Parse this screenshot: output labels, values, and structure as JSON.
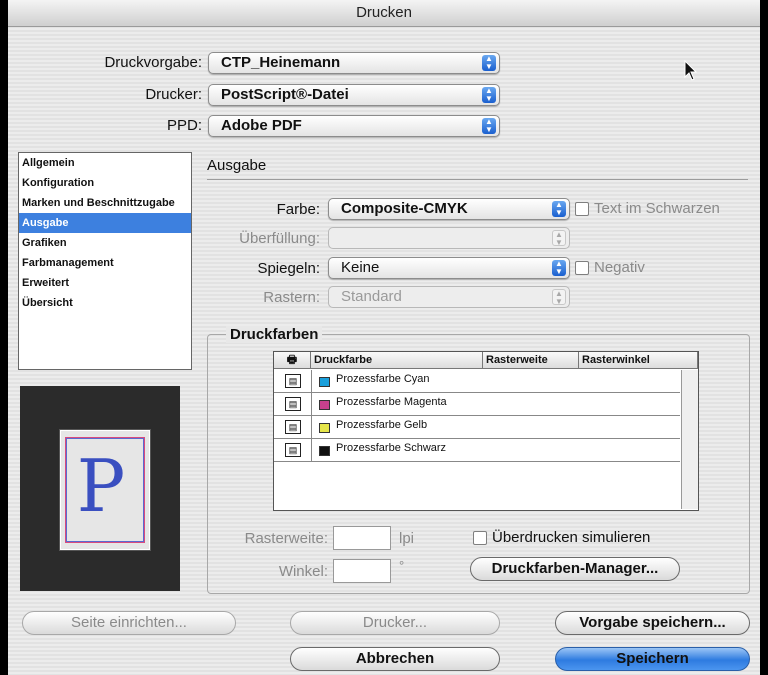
{
  "window": {
    "title": "Drucken"
  },
  "top_fields": {
    "preset_label": "Druckvorgabe:",
    "preset_value": "CTP_Heinemann",
    "printer_label": "Drucker:",
    "printer_value": "PostScript®-Datei",
    "ppd_label": "PPD:",
    "ppd_value": "Adobe PDF"
  },
  "sidebar": {
    "items": [
      {
        "label": "Allgemein"
      },
      {
        "label": "Konfiguration"
      },
      {
        "label": "Marken und Beschnittzugabe"
      },
      {
        "label": "Ausgabe"
      },
      {
        "label": "Grafiken"
      },
      {
        "label": "Farbmanagement"
      },
      {
        "label": "Erweitert"
      },
      {
        "label": "Übersicht"
      }
    ],
    "selected": "Ausgabe"
  },
  "preview": {
    "letter": "P"
  },
  "output": {
    "section_title": "Ausgabe",
    "color_label": "Farbe:",
    "color_value": "Composite-CMYK",
    "text_black_label": "Text im Schwarzen",
    "trapping_label": "Überfüllung:",
    "trapping_value": "",
    "mirror_label": "Spiegeln:",
    "mirror_value": "Keine",
    "negative_label": "Negativ",
    "screening_label": "Rastern:",
    "screening_value": "Standard"
  },
  "inks": {
    "group_title": "Druckfarben",
    "columns": [
      "Druckfarbe",
      "Rasterweite",
      "Rasterwinkel"
    ],
    "rows": [
      {
        "name": "Prozessfarbe Cyan",
        "color": "#1aa0dc"
      },
      {
        "name": "Prozessfarbe Magenta",
        "color": "#c8408c"
      },
      {
        "name": "Prozessfarbe Gelb",
        "color": "#e6e64a"
      },
      {
        "name": "Prozessfarbe Schwarz",
        "color": "#111111"
      }
    ],
    "frequency_label": "Rasterweite:",
    "frequency_value": "",
    "frequency_unit": "lpi",
    "angle_label": "Winkel:",
    "angle_value": "",
    "angle_unit": "°",
    "simulate_overprint_label": "Überdrucken simulieren",
    "ink_manager_button": "Druckfarben-Manager..."
  },
  "buttons": {
    "page_setup": "Seite einrichten...",
    "printer": "Drucker...",
    "save_preset": "Vorgabe speichern...",
    "cancel": "Abbrechen",
    "save": "Speichern"
  }
}
